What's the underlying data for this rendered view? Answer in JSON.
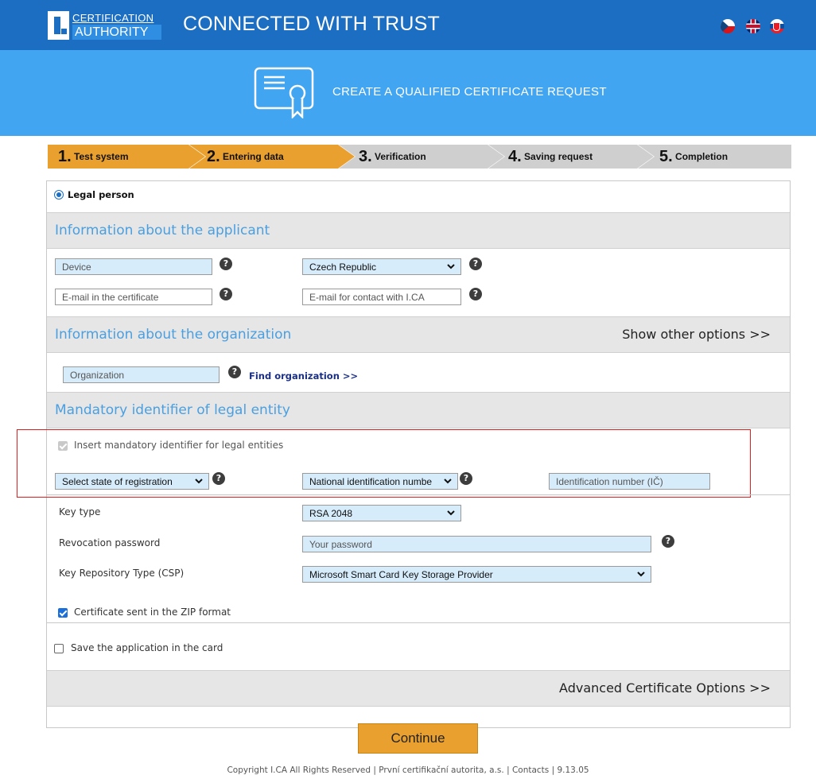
{
  "header": {
    "logo_line1": "CERTIFICATION",
    "logo_line2": "AUTHORITY",
    "tagline": "CONNECTED WITH TRUST",
    "flags": [
      "czech-flag-icon",
      "uk-flag-icon",
      "slovak-flag-icon"
    ]
  },
  "banner": {
    "icon": "certificate-icon",
    "title": "CREATE A QUALIFIED CERTIFICATE REQUEST"
  },
  "steps": [
    {
      "num": "1.",
      "label": "Test system",
      "state": "done"
    },
    {
      "num": "2.",
      "label": "Entering data",
      "state": "active"
    },
    {
      "num": "3.",
      "label": "Verification",
      "state": "todo"
    },
    {
      "num": "4.",
      "label": "Saving request",
      "state": "todo"
    },
    {
      "num": "5.",
      "label": "Completion",
      "state": "todo"
    }
  ],
  "form": {
    "person_type": "Legal person",
    "applicant": {
      "title": "Information about the applicant",
      "device_placeholder": "Device",
      "country_selected": "Czech Republic",
      "email_cert_placeholder": "E-mail in the certificate",
      "email_contact_placeholder": "E-mail for contact with I.CA"
    },
    "organization": {
      "title": "Information about the organization",
      "show_options": "Show other options >>",
      "org_placeholder": "Organization",
      "find_link": "Find organization >>"
    },
    "identifier": {
      "title": "Mandatory identifier of legal entity",
      "checkbox_label": "Insert mandatory identifier for legal entities",
      "state_select": "Select state of registration",
      "id_type_select": "National identification numbe",
      "id_number_placeholder": "Identification number (IČ)"
    },
    "key_type_label": "Key type",
    "key_type_value": "RSA 2048",
    "revocation_label": "Revocation password",
    "revocation_placeholder": "Your password",
    "csp_label": "Key Repository Type (CSP)",
    "csp_value": "Microsoft Smart Card Key Storage Provider",
    "zip_label": "Certificate sent in the ZIP format",
    "save_card_label": "Save the application in the card",
    "advanced_options": "Advanced Certificate Options >>",
    "continue": "Continue"
  },
  "colors": {
    "topbar": "#1b6ec2",
    "banner": "#41a5f1",
    "step_active": "#e9a02e",
    "step_inactive": "#cfcfcf",
    "section_title": "#4a9fe0",
    "highlight": "#e02020"
  },
  "footer": "Copyright I.CA All Rights Reserved  |  První certifikační autorita, a.s.  |  Contacts  |  9.13.05"
}
